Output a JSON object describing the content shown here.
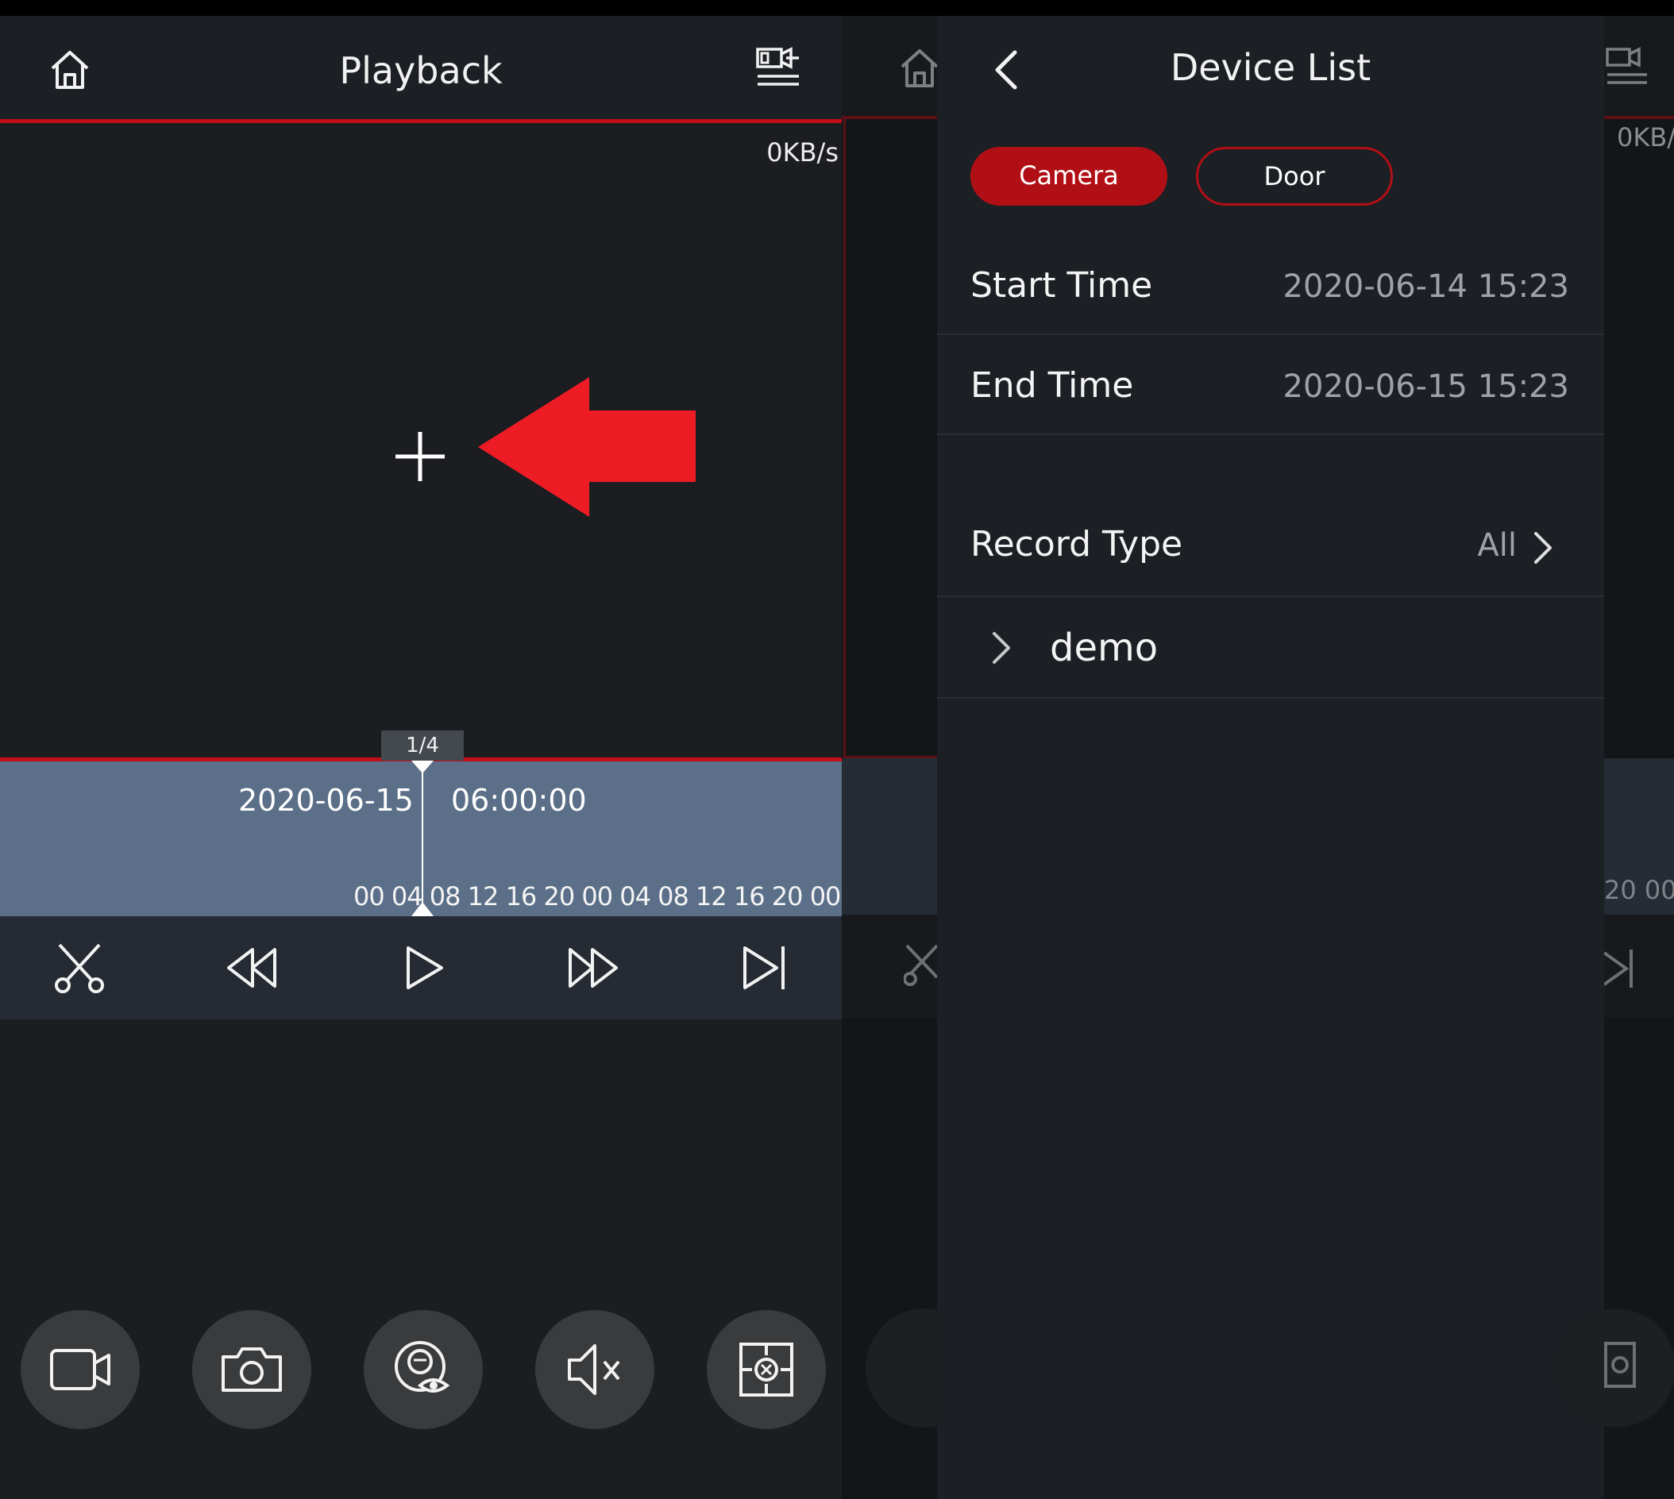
{
  "playback": {
    "title": "Playback",
    "speed": "0KB/s",
    "pager": "1/4",
    "timeline_date": "2020-06-15",
    "timeline_time": "06:00:00",
    "timeline_ticks": "00 04 08 12 16 20 00 04 08 12 16 20 00 04",
    "icons": {
      "header": [
        "home-icon",
        "camera-list-icon"
      ],
      "controls": [
        "scissors-icon",
        "rewind-icon",
        "play-icon",
        "fast-forward-icon",
        "skip-next-icon"
      ],
      "bottom": [
        "record-video-icon",
        "snapshot-icon",
        "fisheye-icon",
        "mute-icon",
        "digital-zoom-icon"
      ]
    },
    "annotation_arrow_color": "#ed1c24"
  },
  "drawer": {
    "title": "Device List",
    "tabs": [
      "Camera",
      "Door"
    ],
    "active_tab": "Camera",
    "start_time_label": "Start Time",
    "start_time_value": "2020-06-14 15:23",
    "end_time_label": "End Time",
    "end_time_value": "2020-06-15 15:23",
    "record_type_label": "Record Type",
    "record_type_value": "All",
    "device_name": "demo",
    "accent_color": "#b10f16"
  },
  "background_right": {
    "speed": "0KB/",
    "ticks": "20 00 0"
  }
}
